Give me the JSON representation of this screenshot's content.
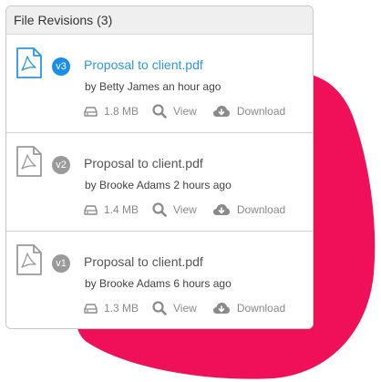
{
  "header": {
    "title": "File Revisions",
    "count": "(3)"
  },
  "colors": {
    "accent": "#1a8ee8",
    "link": "#2b98e4",
    "muted": "#9a9a9a",
    "blob": "#f0105a"
  },
  "revisions": [
    {
      "version": "v3",
      "filename": "Proposal to client.pdf",
      "byline": "by Betty James an hour ago",
      "size": "1.8 MB",
      "view_label": "View",
      "download_label": "Download",
      "active": true,
      "icon": "pdf-file-icon"
    },
    {
      "version": "v2",
      "filename": "Proposal to client.pdf",
      "byline": "by Brooke Adams 2 hours ago",
      "size": "1.4 MB",
      "view_label": "View",
      "download_label": "Download",
      "active": false,
      "icon": "pdf-file-icon"
    },
    {
      "version": "v1",
      "filename": "Proposal to client.pdf",
      "byline": "by Brooke Adams 6 hours ago",
      "size": "1.3 MB",
      "view_label": "View",
      "download_label": "Download",
      "active": false,
      "icon": "pdf-file-icon"
    }
  ]
}
